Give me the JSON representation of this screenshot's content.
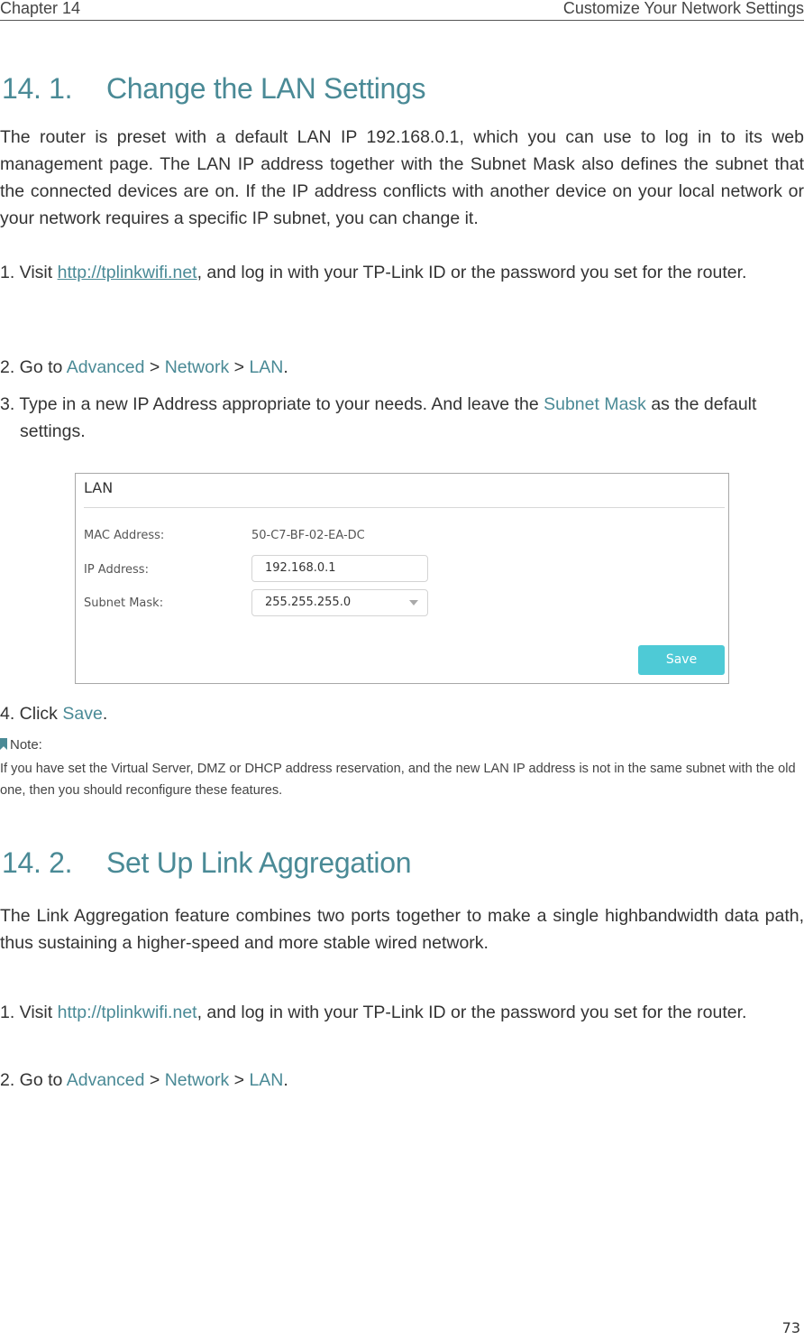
{
  "header": {
    "chapter": "Chapter 14",
    "chapter_title": "Customize Your Network Settings"
  },
  "section1": {
    "number": "14. 1.",
    "title": "Change the LAN Settings",
    "intro": "The router is preset with a default LAN IP 192.168.0.1, which you can use to log in to its web management page. The LAN IP address together with the Subnet Mask also defines the subnet that the connected devices are on. If the IP address conflicts with another device on your local network or your network requires a specific IP subnet, you can change it.",
    "step1": {
      "prefix": "1. Visit ",
      "link": "http://tplinkwifi.net",
      "suffix": ", and log in with your TP-Link ID or the password you set for the router."
    },
    "step2": {
      "prefix": "2. Go to ",
      "path": [
        "Advanced",
        "Network",
        "LAN"
      ],
      "sep": " > ",
      "end": "."
    },
    "step3": {
      "prefix": "3. Type in a new IP Address appropriate to your needs. And leave the ",
      "highlight": "Subnet Mask",
      "suffix": " as the default settings."
    },
    "step4": {
      "prefix": "4. Click ",
      "highlight": "Save",
      "suffix": "."
    }
  },
  "lan_panel": {
    "title": "LAN",
    "mac_label": "MAC Address:",
    "mac_value": "50-C7-BF-02-EA-DC",
    "ip_label": "IP Address:",
    "ip_value": "192.168.0.1",
    "mask_label": "Subnet Mask:",
    "mask_value": "255.255.255.0",
    "save_label": "Save",
    "save_color": "#4ecad6"
  },
  "note": {
    "icon": "bookmark-icon",
    "title": "Note:",
    "body": "If you have set the Virtual Server, DMZ or DHCP address reservation, and the new LAN IP address is not in the same subnet with the old one, then you should reconfigure these features."
  },
  "section2": {
    "number": "14. 2.",
    "title": "Set Up Link Aggregation",
    "intro": "The Link Aggregation feature combines two ports together to make a single highbandwidth data path, thus sustaining a higher-speed and more stable wired network.",
    "step1": {
      "prefix": "1. Visit ",
      "link": "http://tplinkwifi.net",
      "suffix": ", and log in with your TP-Link ID or the password you set for the router."
    },
    "step2": {
      "prefix": "2. Go to ",
      "path": [
        "Advanced",
        "Network",
        "LAN"
      ],
      "sep": " > ",
      "end": "."
    }
  },
  "page_number": "73",
  "accent_color": "#4a8a96"
}
